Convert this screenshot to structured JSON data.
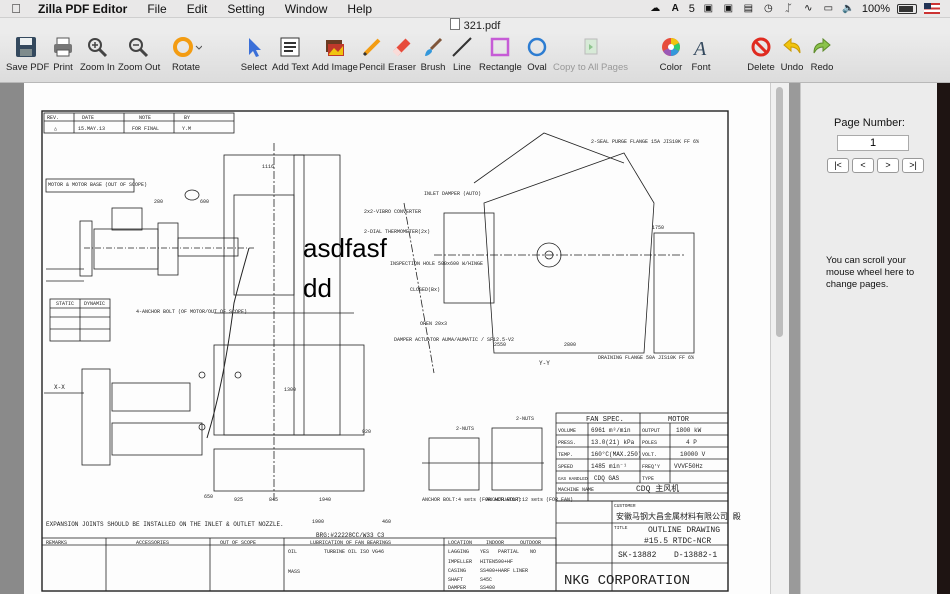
{
  "menubar": {
    "app_name": "Zilla PDF Editor",
    "menus": [
      "File",
      "Edit",
      "Setting",
      "Window",
      "Help"
    ],
    "status": {
      "num": "5",
      "battery": "100%"
    }
  },
  "window": {
    "title": "321.pdf"
  },
  "toolbar": {
    "save": "Save PDF",
    "print": "Print",
    "zoom_in": "Zoom In",
    "zoom_out": "Zoom Out",
    "rotate": "Rotate",
    "select": "Select",
    "add_text": "Add Text",
    "add_image": "Add Image",
    "pencil": "Pencil",
    "eraser": "Eraser",
    "brush": "Brush",
    "line": "Line",
    "rectangle": "Rectangle",
    "oval": "Oval",
    "copy_all": "Copy to All Pages",
    "color": "Color",
    "font": "Font",
    "delete": "Delete",
    "undo": "Undo",
    "redo": "Redo"
  },
  "sidebar": {
    "page_number_label": "Page Number:",
    "page_number": "1",
    "nav": [
      "|<",
      "<",
      ">",
      ">|"
    ],
    "hint": "You can scroll your mouse wheel here to change pages."
  },
  "document": {
    "annotation_line1": "asdfasf",
    "annotation_line2": "dd",
    "rev_header": [
      "REV.",
      "DATE",
      "NOTE",
      "BY"
    ],
    "rev_row": [
      "△",
      "15.MAY.13",
      "FOR FINAL",
      "Y.M"
    ],
    "fan_spec_title": "FAN SPEC.",
    "motor_title": "MOTOR",
    "fan_spec_rows": [
      [
        "VOLUME",
        "6961 m³/min",
        "OUTPUT",
        "1800 kW"
      ],
      [
        "PRESS.",
        "13.0(21) kPa",
        "POLES",
        "4 P"
      ],
      [
        "TEMP.",
        "160°C(MAX.250)",
        "VOLT.",
        "10000 V"
      ],
      [
        "SPEED",
        "1485 min⁻¹",
        "FREQ'Y",
        "VVVF50Hz"
      ],
      [
        "GAS HANDLED",
        "CDQ GAS",
        "TYPE",
        ""
      ]
    ],
    "machine_name": "MACHINE NAME",
    "machine_value": "CDQ 主风机",
    "customer_label": "CUSTOMER",
    "customer": "安徽马钢大昌金属材料有限公司 殿",
    "title_label": "TITLE",
    "drawing_title1": "OUTLINE DRAWING",
    "drawing_title2": "#15.5 RTDC-NCR",
    "dwg_no": "SK-13882",
    "dwg_no2": "D-13882-1",
    "company": "NKG CORPORATION",
    "expansion_note": "EXPANSION JOINTS SHOULD BE INSTALLED ON THE INLET & OUTLET NOZZLE.",
    "brg_label": "BRG:#22228CC/W33 C3",
    "labels": {
      "motor_base": "MOTOR & MOTOR BASE (OUT OF SCOPE)",
      "anchor_bolt": "4-ANCHOR BOLT (OF MOTOR/OUT OF SCOPE)",
      "static_dynamic": [
        "STATIC",
        "DYNAMIC"
      ],
      "seal_purge": "2-SEAL PURGE FLANGE 15A JIS10K FF 6%",
      "inlet_damper": "INLET DAMPER (AUTO)",
      "vibro": "2x2-VIBRO CONVERTER",
      "dial_thermo": "2-DIAL THERMOMETER(2x)",
      "inspection": "INSPECTION HOLE 500x600 W/HINGE",
      "closed": "CLOSED(Bx)",
      "damper_actuator": "DAMPER ACTUATOR AUMA/AUMATIC / SF12.5-V2",
      "open": "OPEN 20x3",
      "draining": "DRAINING FLANGE 50A JIS10K FF 6%",
      "xx": "X-X",
      "yy": "Y-Y",
      "anchor_actuator": "ANCHOR BOLT:4 sets (FOR ACTUATOR)",
      "anchor_fan": "ANCHOR BOLT:12 sets (FOR FAN)",
      "nuts": "2-NUTS"
    },
    "dims": [
      "280",
      "600",
      "1116",
      "2550",
      "2800",
      "1750",
      "1940",
      "1900",
      "1300",
      "650",
      "460",
      "920",
      "1050",
      "1180",
      "1250",
      "850",
      "925",
      "845",
      "1400"
    ],
    "remarks_header": "REMARKS",
    "accessories_header": "ACCESSORIES",
    "out_of_scope_header": "OUT OF SCOPE",
    "lubrication_header": "LUBRICATION OF FAN BEARINGS",
    "location_header": "LOCATION",
    "location_opts": [
      "INDOOR",
      "OUTDOOR"
    ],
    "oil_row": [
      "OIL",
      "TURBINE OIL ISO VG46"
    ],
    "lagging_row": [
      "LAGGING",
      "YES",
      "PARTIAL",
      "NO"
    ],
    "material_rows": [
      [
        "IMPELLER",
        "HITEN590+HF"
      ],
      [
        "CASING",
        "SS400+HARF LINER"
      ],
      [
        "SHAFT",
        "S45C"
      ],
      [
        "DAMPER",
        "SS400"
      ]
    ],
    "mass_label": "MASS"
  }
}
